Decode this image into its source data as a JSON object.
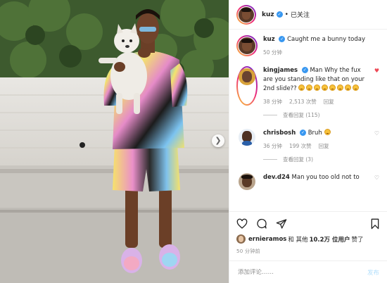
{
  "post": {
    "author": "kuz",
    "follow_state": "已关注",
    "caption_author": "kuz",
    "caption": "Caught me a bunny today",
    "caption_time": "50 分钟"
  },
  "comments": [
    {
      "user": "kingjames",
      "text": "Man Why the fux are you standing like that on your 2nd slide??",
      "emoji_count": 8,
      "time": "38 分钟",
      "likes": "2,513 次赞",
      "reply": "回复",
      "view_replies": "查看回复 (115)",
      "liked": true
    },
    {
      "user": "chrisbosh",
      "text": "Bruh",
      "emoji_count": 1,
      "time": "36 分钟",
      "likes": "199 次赞",
      "reply": "回复",
      "view_replies": "查看回复 (3)",
      "liked": false
    },
    {
      "user": "dev.d24",
      "text": "Man you too old not to",
      "emoji_count": 0,
      "liked": false
    }
  ],
  "likes_line": {
    "liker": "ernieramos",
    "joiner": "和 其他",
    "count": "10.2万 位用户",
    "suffix": "赞了"
  },
  "timestamp": "50 分钟前",
  "composer": {
    "placeholder": "添加评论……",
    "post_label": "发布"
  },
  "icons": {
    "like": "heart-icon",
    "comment": "comment-icon",
    "share": "share-icon",
    "save": "bookmark-icon",
    "next": "chevron-right-icon",
    "more": "more-icon"
  },
  "colors": {
    "verified": "#3897f0",
    "like_red": "#ed4956",
    "muted": "#8e8e8e",
    "post_disabled": "#b2dffc"
  }
}
